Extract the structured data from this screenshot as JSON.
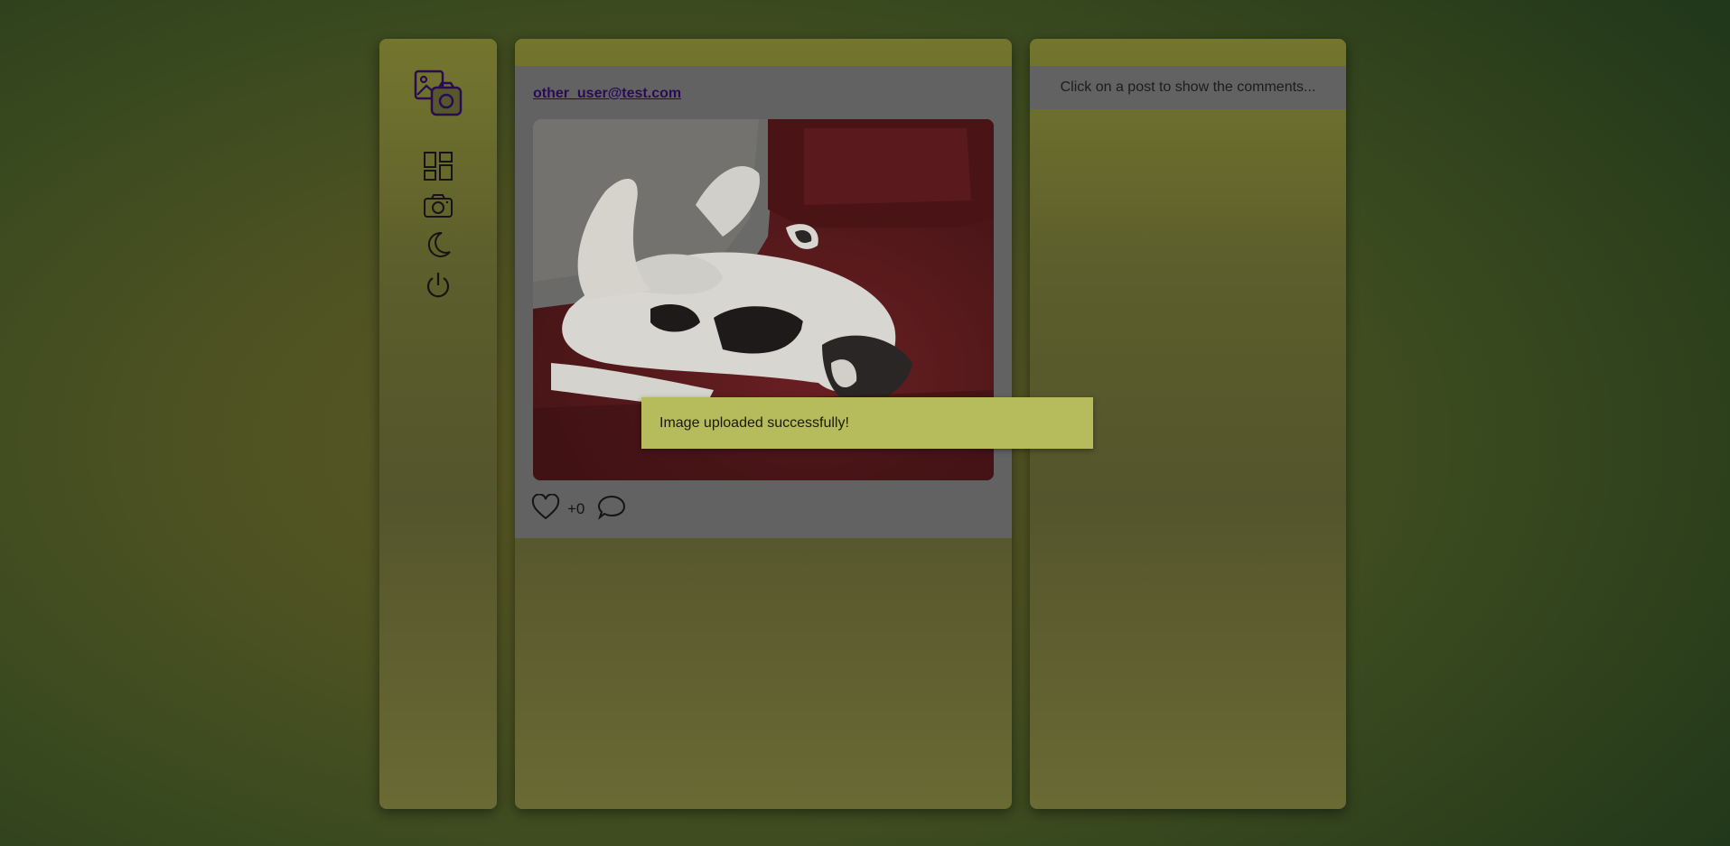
{
  "nav": {
    "logo_icon": "gallery-camera-icon",
    "items": [
      {
        "name": "dashboard-icon"
      },
      {
        "name": "camera-icon"
      },
      {
        "name": "moon-icon"
      },
      {
        "name": "power-icon"
      }
    ]
  },
  "feed": {
    "posts": [
      {
        "author": "other_user@test.com",
        "image": "cat-photo",
        "likes": "+0"
      }
    ]
  },
  "comments": {
    "hint": "Click on a post to show the comments..."
  },
  "toast": {
    "message": "Image uploaded successfully!"
  },
  "colors": {
    "link": "#2a0a55",
    "toast": "#b6bb5c",
    "card": "#626262"
  }
}
